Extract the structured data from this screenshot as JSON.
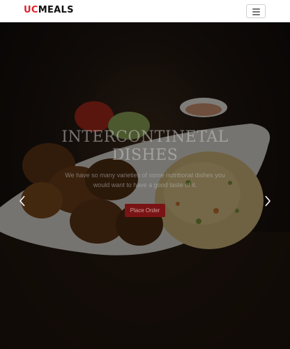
{
  "navbar": {
    "brand_prefix": "UC",
    "brand_suffix": "MEALS",
    "menu_icon": "hamburger-icon"
  },
  "hero": {
    "title": "INTERCONTINETAL DISHES",
    "description": "We have so many varieties of some nutritional dishes you would want to have a good taste of it.",
    "button_label": "Place Order",
    "prev_icon": "chevron-left-icon",
    "next_icon": "chevron-right-icon"
  },
  "colors": {
    "brand_red": "#e0202a",
    "button_red": "#7a1414"
  }
}
